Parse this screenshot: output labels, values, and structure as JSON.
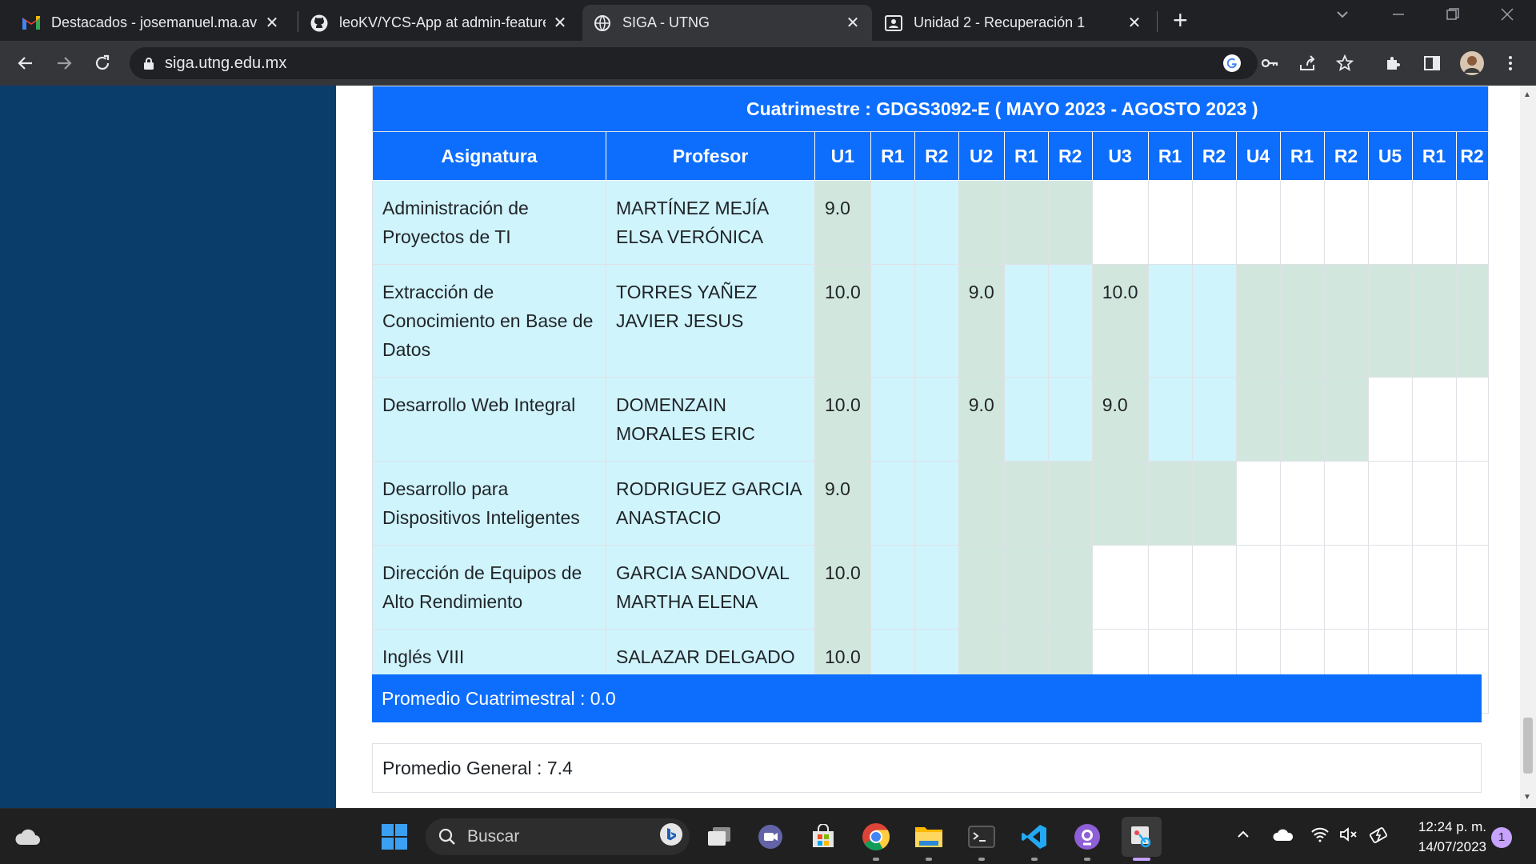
{
  "browser": {
    "tabs": [
      {
        "title": "Destacados - josemanuel.ma.av@",
        "icon": "gmail-icon",
        "active": false
      },
      {
        "title": "leoKV/YCS-App at admin-feature",
        "icon": "github-icon",
        "active": false
      },
      {
        "title": "SIGA - UTNG",
        "icon": "globe-icon",
        "active": true
      },
      {
        "title": "Unidad 2 - Recuperación 1",
        "icon": "classroom-icon",
        "active": false
      }
    ],
    "close_glyph": "✕",
    "new_tab_glyph": "+",
    "url": "siga.utng.edu.mx"
  },
  "grades": {
    "term_label": "Cuatrimestre : GDGS3092-E ( MAYO 2023 - AGOSTO 2023 )",
    "columns": [
      "Asignatura",
      "Profesor",
      "U1",
      "R1",
      "R2",
      "U2",
      "R1",
      "R2",
      "U3",
      "R1",
      "R2",
      "U4",
      "R1",
      "R2",
      "U5",
      "R1",
      "R2"
    ],
    "rows": [
      {
        "subject": "Administración de Proyectos de TI",
        "teacher": "MARTÍNEZ MEJÍA ELSA VERÓNICA",
        "grades": [
          "9.0",
          "",
          "",
          "",
          "",
          "",
          "",
          "",
          "",
          "",
          "",
          "",
          "",
          "",
          ""
        ]
      },
      {
        "subject": "Extracción de Conocimiento en Base de Datos",
        "teacher": "TORRES YAÑEZ JAVIER JESUS",
        "grades": [
          "10.0",
          "",
          "",
          "9.0",
          "",
          "",
          "10.0",
          "",
          "",
          "",
          "",
          "",
          "",
          "",
          ""
        ]
      },
      {
        "subject": "Desarrollo Web Integral",
        "teacher": "DOMENZAIN MORALES ERIC",
        "grades": [
          "10.0",
          "",
          "",
          "9.0",
          "",
          "",
          "9.0",
          "",
          "",
          "",
          "",
          "",
          "",
          "",
          ""
        ]
      },
      {
        "subject": "Desarrollo para Dispositivos Inteligentes",
        "teacher": "RODRIGUEZ GARCIA ANASTACIO",
        "grades": [
          "9.0",
          "",
          "",
          "",
          "",
          "",
          "",
          "",
          "",
          "",
          "",
          "",
          "",
          "",
          ""
        ]
      },
      {
        "subject": "Dirección de Equipos de Alto Rendimiento",
        "teacher": "GARCIA SANDOVAL MARTHA ELENA",
        "grades": [
          "10.0",
          "",
          "",
          "",
          "",
          "",
          "",
          "",
          "",
          "",
          "",
          "",
          "",
          "",
          ""
        ]
      },
      {
        "subject": "Inglés VIII",
        "teacher": "SALAZAR DELGADO CÉSAR ALEJANDRO",
        "grades": [
          "10.0",
          "",
          "",
          "",
          "",
          "",
          "",
          "",
          "",
          "",
          "",
          "",
          "",
          "",
          ""
        ]
      }
    ],
    "cell_colors": [
      [
        "b",
        "b",
        "g",
        "b",
        "b",
        "g",
        "g",
        "g",
        "w",
        "w",
        "w",
        "w",
        "w",
        "w",
        "w",
        "w",
        "w"
      ],
      [
        "b",
        "b",
        "g",
        "b",
        "b",
        "g",
        "b",
        "b",
        "g",
        "b",
        "b",
        "g",
        "g",
        "g",
        "g",
        "g",
        "g"
      ],
      [
        "b",
        "b",
        "g",
        "b",
        "b",
        "g",
        "b",
        "b",
        "g",
        "b",
        "b",
        "g",
        "g",
        "g",
        "w",
        "w",
        "w"
      ],
      [
        "b",
        "b",
        "g",
        "b",
        "b",
        "g",
        "g",
        "g",
        "g",
        "g",
        "g",
        "w",
        "w",
        "w",
        "w",
        "w",
        "w"
      ],
      [
        "b",
        "b",
        "g",
        "b",
        "b",
        "g",
        "g",
        "g",
        "w",
        "w",
        "w",
        "w",
        "w",
        "w",
        "w",
        "w",
        "w"
      ],
      [
        "b",
        "b",
        "g",
        "b",
        "b",
        "g",
        "g",
        "g",
        "w",
        "w",
        "w",
        "w",
        "w",
        "w",
        "w",
        "w",
        "w"
      ]
    ],
    "term_average": "Promedio Cuatrimestral : 0.0",
    "general_average": "Promedio General : 7.4"
  },
  "colors": {
    "primary": "#0d6efd",
    "info_light": "#cff4fc",
    "success_light": "#d1e7dd",
    "sidebar": "#0b3d6b"
  },
  "taskbar": {
    "search_placeholder": "Buscar",
    "time": "12:24 p. m.",
    "date": "14/07/2023",
    "notification_count": "1"
  }
}
